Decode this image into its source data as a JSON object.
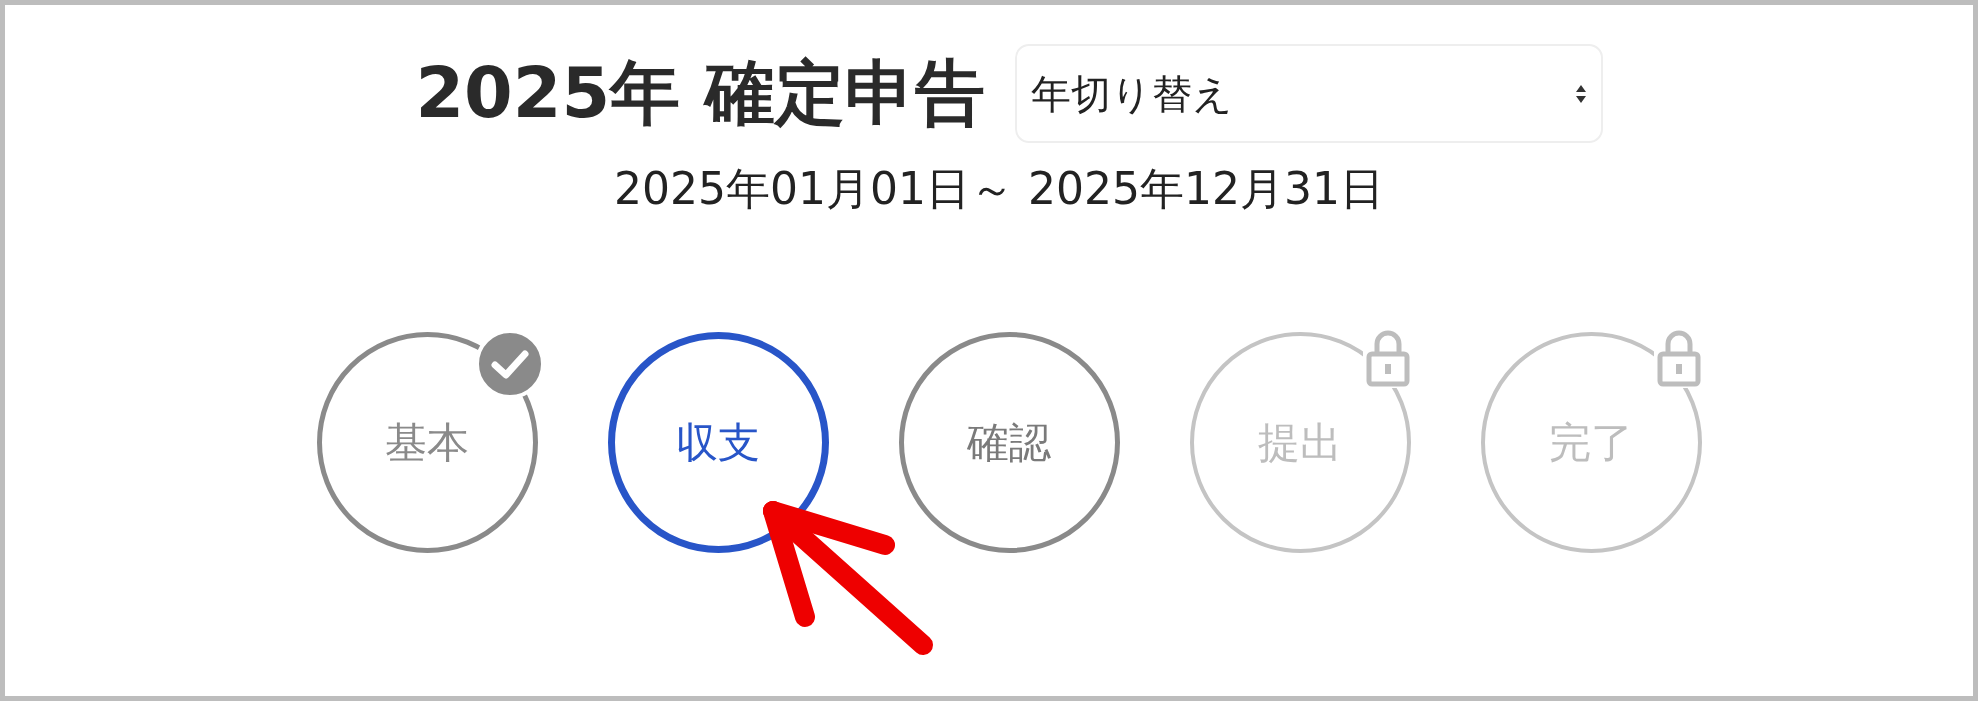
{
  "header": {
    "title": "2025年 確定申告",
    "year_select": {
      "value": "年切り替え"
    }
  },
  "period": "2025年01月01日～ 2025年12月31日",
  "steps": [
    {
      "label": "基本",
      "kind": "done",
      "selected": false
    },
    {
      "label": "収支",
      "kind": "open",
      "selected": true
    },
    {
      "label": "確認",
      "kind": "open",
      "selected": false
    },
    {
      "label": "提出",
      "kind": "locked",
      "selected": false
    },
    {
      "label": "完了",
      "kind": "locked",
      "selected": false
    }
  ]
}
